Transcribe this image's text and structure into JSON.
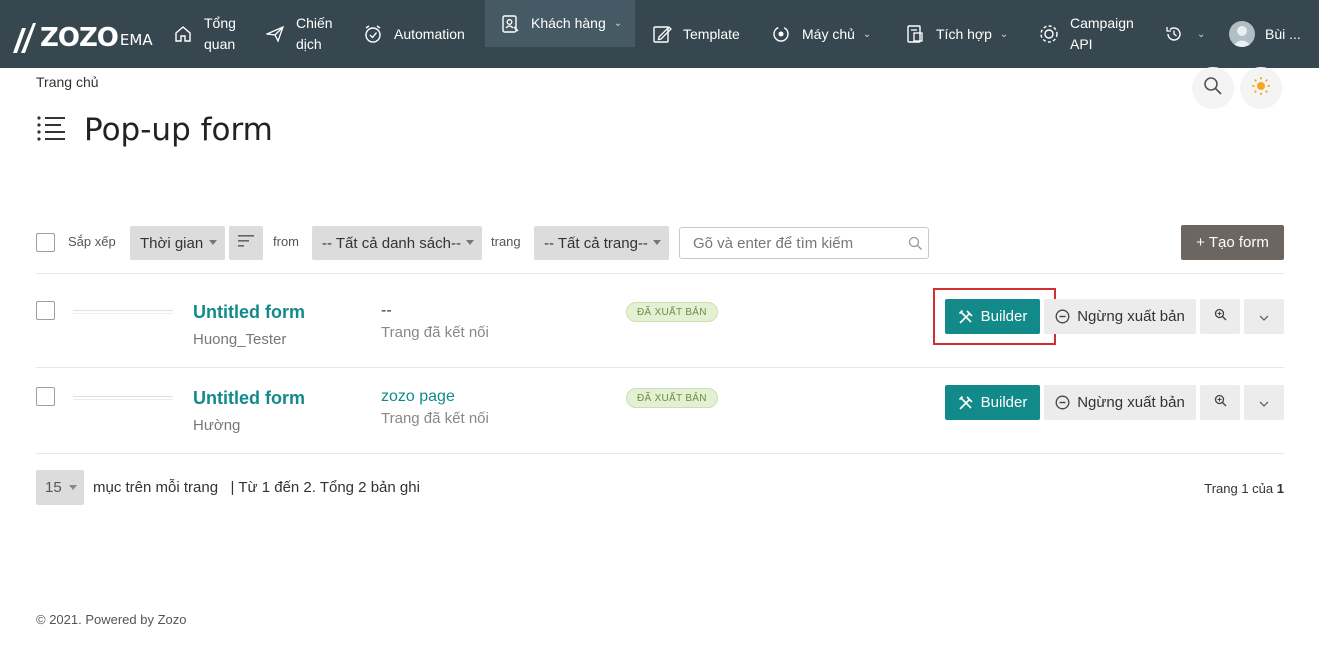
{
  "nav": {
    "logo": {
      "text": "ZOZO",
      "sub": "EMA"
    },
    "items": [
      {
        "label": "Tổng\nquan",
        "icon": "home-icon"
      },
      {
        "label": "Chiến\ndịch",
        "icon": "send-icon"
      },
      {
        "label": "Automation",
        "icon": "alarm-clock-icon"
      },
      {
        "label": "Khách hàng",
        "icon": "contacts-icon",
        "active": true
      },
      {
        "label": "Template",
        "icon": "edit-icon"
      },
      {
        "label": "Máy chủ",
        "icon": "sync-icon"
      },
      {
        "label": "Tích hợp",
        "icon": "integration-icon"
      },
      {
        "label": "Campaign\nAPI",
        "icon": "gear-icon"
      }
    ],
    "user": "Bùi ..."
  },
  "breadcrumb": "Trang chủ",
  "page_title": "Pop-up form",
  "filters": {
    "sort_label": "Sắp xếp",
    "sort_value": "Thời gian",
    "from_label": "from",
    "list_value": "-- Tất cả danh sách--",
    "page_label": "trang",
    "page_value": "-- Tất cả trang--",
    "search_placeholder": "Gõ và enter để tìm kiếm",
    "create_label": "+ Tạo form"
  },
  "rows": [
    {
      "name": "Untitled form",
      "owner": "Huong_Tester",
      "page": "--",
      "connected": "Trang đã kết nối",
      "status": "ĐÃ XUẤT BẢN",
      "builder_label": "Builder",
      "unpublish_label": "Ngừng xuất bản"
    },
    {
      "name": "Untitled form",
      "owner": "Hường",
      "page": "zozo page",
      "connected": "Trang đã kết nối",
      "status": "ĐÃ XUẤT BẢN",
      "builder_label": "Builder",
      "unpublish_label": "Ngừng xuất bản"
    }
  ],
  "pager": {
    "per_page": "15",
    "summary": "mục trên mỗi trang   | Từ 1 đến 2. Tổng 2 bản ghi",
    "page_prefix": "Trang 1 của",
    "total_pages": "1"
  },
  "footer": "© 2021. Powered by Zozo",
  "colors": {
    "nav_bg": "#37474f",
    "accent": "#138a8a",
    "highlight": "#d32f2f"
  }
}
